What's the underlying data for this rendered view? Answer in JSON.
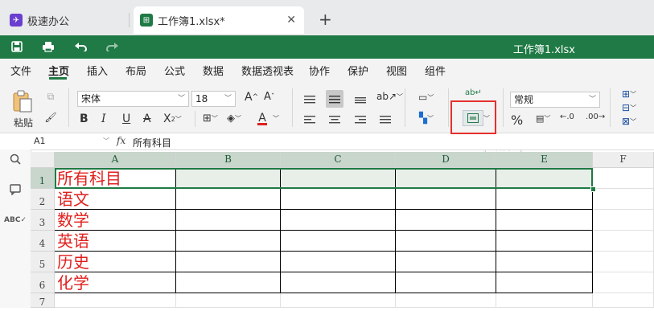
{
  "tabs": [
    {
      "label": "极速办公",
      "active": false
    },
    {
      "label": "工作簿1.xlsx*",
      "active": true
    }
  ],
  "doc_title": "工作簿1.xlsx",
  "menu": [
    "文件",
    "主页",
    "插入",
    "布局",
    "公式",
    "数据",
    "数据透视表",
    "协作",
    "保护",
    "视图",
    "组件"
  ],
  "active_menu": "主页",
  "ribbon": {
    "paste_label": "粘贴",
    "font_name": "宋体",
    "font_size": "18",
    "number_format": "常规",
    "merge_tooltip": "合并"
  },
  "formula_bar": {
    "name_box": "A1",
    "fx": "fx",
    "content": "所有科目"
  },
  "columns": [
    "A",
    "B",
    "C",
    "D",
    "E",
    "F"
  ],
  "rows": [
    "1",
    "2",
    "3",
    "4",
    "5",
    "6",
    "7"
  ],
  "cells": [
    "所有科目",
    "语文",
    "数学",
    "英语",
    "历史",
    "化学"
  ],
  "colors": {
    "brand_green": "#1f7a45",
    "cell_text_red": "#e0201e",
    "highlight_red": "#e5302d"
  }
}
